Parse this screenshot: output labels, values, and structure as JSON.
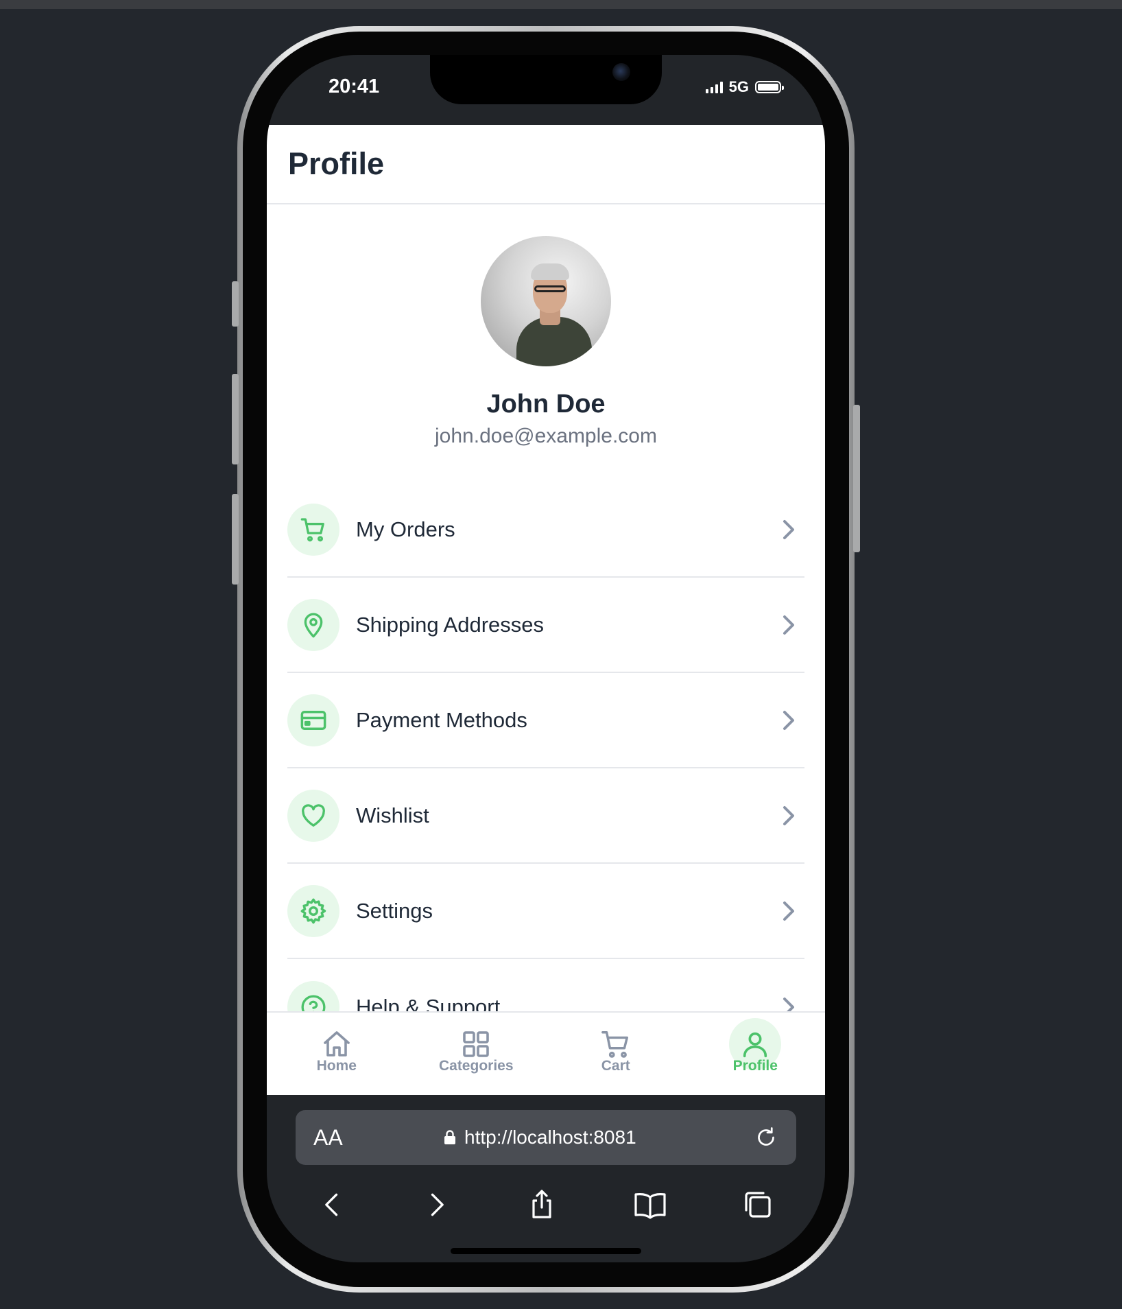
{
  "status_bar": {
    "time": "20:41",
    "network": "5G"
  },
  "header": {
    "title": "Profile"
  },
  "profile": {
    "name": "John Doe",
    "email": "john.doe@example.com"
  },
  "menu": [
    {
      "label": "My Orders",
      "icon": "cart-icon"
    },
    {
      "label": "Shipping Addresses",
      "icon": "location-pin-icon"
    },
    {
      "label": "Payment Methods",
      "icon": "credit-card-icon"
    },
    {
      "label": "Wishlist",
      "icon": "heart-icon"
    },
    {
      "label": "Settings",
      "icon": "gear-icon"
    },
    {
      "label": "Help & Support",
      "icon": "help-circle-icon"
    }
  ],
  "tabs": [
    {
      "label": "Home",
      "icon": "home-icon",
      "active": false
    },
    {
      "label": "Categories",
      "icon": "grid-icon",
      "active": false
    },
    {
      "label": "Cart",
      "icon": "cart-icon",
      "active": false
    },
    {
      "label": "Profile",
      "icon": "user-icon",
      "active": true
    }
  ],
  "browser": {
    "text_size_label": "AA",
    "url": "http://localhost:8081"
  },
  "colors": {
    "accent": "#4cc26a",
    "accent_bg": "#e7f8ea",
    "text_dark": "#1f2937",
    "text_muted": "#6b7280",
    "backdrop": "#23272d"
  }
}
